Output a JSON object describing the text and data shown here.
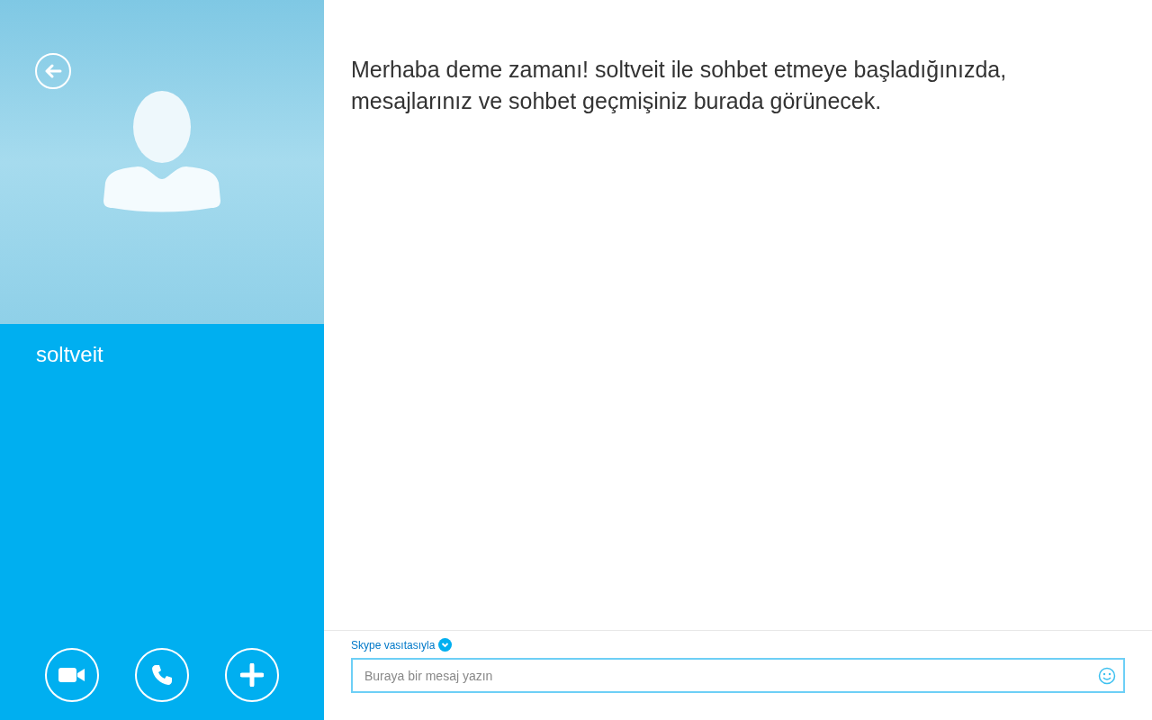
{
  "contact": {
    "name": "soltveit"
  },
  "conversation": {
    "intro": "Merhaba deme zamanı! soltveit ile sohbet etmeye başladığınızda, mesajlarınız ve sohbet geçmişiniz burada görünecek."
  },
  "composer": {
    "via": "Skype vasıtasıyla",
    "placeholder": "Buraya bir mesaj yazın"
  },
  "actions": [
    {
      "kind": "video"
    },
    {
      "kind": "call"
    },
    {
      "kind": "add"
    }
  ]
}
